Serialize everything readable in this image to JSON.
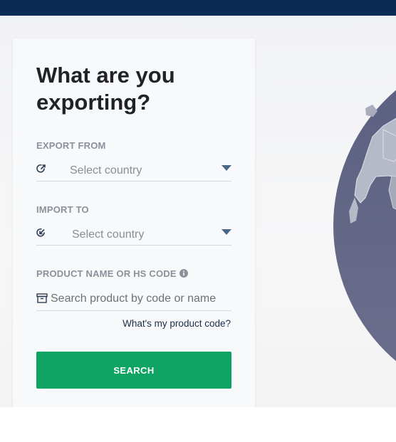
{
  "form": {
    "title": "What are you exporting?",
    "export_from_label": "EXPORT FROM",
    "export_from_value": "Select country",
    "import_to_label": "IMPORT TO",
    "import_to_value": "Select country",
    "product_label": "PRODUCT NAME OR HS CODE",
    "product_placeholder": "Search product by code or name",
    "help_link": "What's my product code?",
    "search_button": "SEARCH"
  },
  "icons": {
    "export": "export-arrow-icon",
    "import": "import-arrow-icon",
    "product": "archive-box-icon",
    "info": "info-icon",
    "dropdown": "caret-down-icon"
  },
  "colors": {
    "topbar": "#0b2a54",
    "button": "#0fa464",
    "caret": "#4b6787",
    "globe": "#5d6283"
  }
}
